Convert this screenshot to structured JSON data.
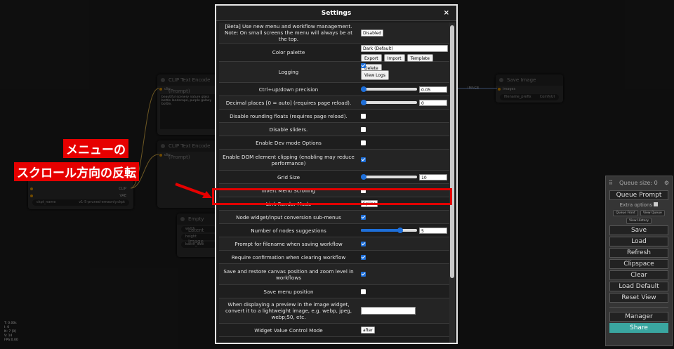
{
  "nodes": {
    "clip1_title": "CLIP Text Encode (Prompt)",
    "clip1_slot": "clip",
    "clip1_text": "beautiful scenery nature glass bottle landscape, purple galaxy bottle,",
    "clip2_title": "CLIP Text Encode (Prompt)",
    "clip2_slot": "clip",
    "ckpt_outputs": [
      "CLIP",
      "VAE"
    ],
    "ckpt_name_label": "ckpt_name",
    "ckpt_name_value": "v1-5-pruned-emaonly.ckpt",
    "latent_title": "Empty Latent Image",
    "latent_width": "width",
    "latent_height": "height",
    "latent_batch": "batch_size",
    "save_title": "Save Image",
    "save_slot": "images",
    "save_prefix_label": "filename_prefix",
    "save_prefix_value": "ComfyUI",
    "image_link_label": "IMAGE"
  },
  "dialog": {
    "title": "Settings",
    "close": "×",
    "rows": [
      {
        "label": "[Beta] Use new menu and workflow management. Note: On small screens the menu will always be at the top.",
        "control": "select",
        "value": "Disabled"
      },
      {
        "label": "Color palette",
        "control": "palette",
        "value": "Dark (Default)",
        "buttons": [
          "Export",
          "Import",
          "Template",
          "Delete"
        ]
      },
      {
        "label": "Logging",
        "control": "checkbox-button",
        "checked": true,
        "button": "View Logs"
      },
      {
        "label": "Ctrl+up/down precision",
        "control": "slider",
        "value": "0.05",
        "fill": 0.05
      },
      {
        "label": "Decimal places [0 = auto] (requires page reload).",
        "control": "slider",
        "value": "0",
        "fill": 0.0
      },
      {
        "label": "Disable rounding floats (requires page reload).",
        "control": "checkbox",
        "checked": false
      },
      {
        "label": "Disable sliders.",
        "control": "checkbox",
        "checked": false
      },
      {
        "label": "Enable Dev mode Options",
        "control": "checkbox",
        "checked": false
      },
      {
        "label": "Enable DOM element clipping (enabling may reduce performance)",
        "control": "checkbox",
        "checked": true
      },
      {
        "label": "Grid Size",
        "control": "slider",
        "value": "10",
        "fill": 0.03
      },
      {
        "label": "Invert Menu Scrolling",
        "control": "checkbox",
        "checked": false
      },
      {
        "label": "Link Render Mode",
        "control": "select",
        "value": "Spline"
      },
      {
        "label": "Node widget/input conversion sub-menus",
        "control": "checkbox",
        "checked": true
      },
      {
        "label": "Number of nodes suggestions",
        "control": "slider",
        "value": "5",
        "fill": 0.7
      },
      {
        "label": "Prompt for filename when saving workflow",
        "control": "checkbox",
        "checked": true
      },
      {
        "label": "Require confirmation when clearing workflow",
        "control": "checkbox",
        "checked": true
      },
      {
        "label": "Save and restore canvas position and zoom level in workflows",
        "control": "checkbox",
        "checked": true
      },
      {
        "label": "Save menu position",
        "control": "checkbox",
        "checked": false
      },
      {
        "label": "When displaying a preview in the image widget, convert it to a lightweight image, e.g. webp, jpeg, webp;50, etc.",
        "control": "text",
        "value": ""
      },
      {
        "label": "Widget Value Control Mode",
        "control": "select",
        "value": "after"
      }
    ]
  },
  "annotation": {
    "line1": "メニューの",
    "line2": "スクロール方向の反転"
  },
  "queue": {
    "size_label": "Queue size: 0",
    "prompt": "Queue Prompt",
    "extra": "Extra options",
    "queue_front": "Queue Front",
    "view_queue": "View Queue",
    "view_history": "View History",
    "buttons": [
      "Save",
      "Load",
      "Refresh",
      "Clipspace",
      "Clear",
      "Load Default",
      "Reset View"
    ],
    "manager": "Manager",
    "share": "Share"
  },
  "stats": [
    "T: 0.00s",
    "I: 0",
    "N: 7 [0]",
    "V: 14",
    "FPS:0.00"
  ],
  "colors": {
    "highlight": "#e30000",
    "accent": "#1e6fd9",
    "share": "#3aa6a0"
  }
}
